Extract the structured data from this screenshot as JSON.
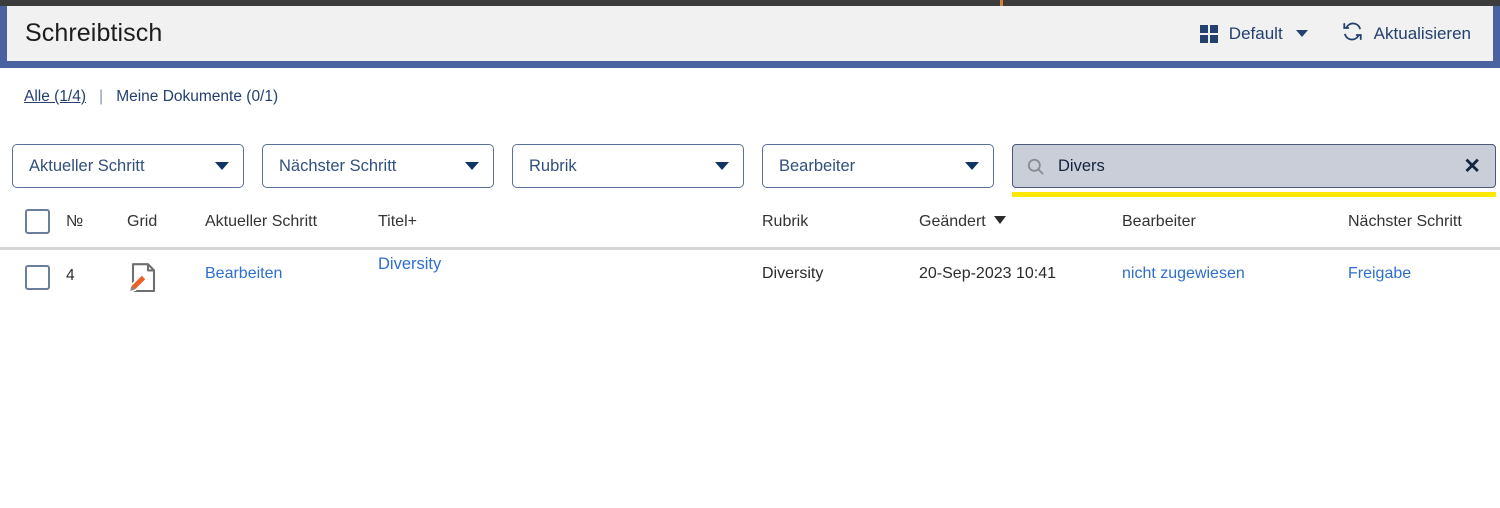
{
  "header": {
    "title": "Schreibtisch",
    "view_button": {
      "label": "Default",
      "icon": "grid-icon"
    },
    "refresh_button": {
      "label": "Aktualisieren",
      "icon": "refresh-icon"
    }
  },
  "filter_tabs": {
    "separator": "|",
    "items": [
      {
        "label": "Alle (1/4)",
        "active": true
      },
      {
        "label": "Meine Dokumente (0/1)",
        "active": false
      }
    ]
  },
  "filters": {
    "dropdowns": [
      {
        "label": "Aktueller Schritt"
      },
      {
        "label": "Nächster Schritt"
      },
      {
        "label": "Rubrik"
      },
      {
        "label": "Bearbeiter"
      }
    ],
    "search": {
      "value": "Divers",
      "placeholder": "",
      "icon": "search-icon",
      "clear_icon": "✕"
    }
  },
  "table": {
    "columns": [
      {
        "key": "checkbox",
        "label": ""
      },
      {
        "key": "no",
        "label": "№"
      },
      {
        "key": "grid",
        "label": "Grid"
      },
      {
        "key": "current_step",
        "label": "Aktueller Schritt"
      },
      {
        "key": "title",
        "label": "Titel+"
      },
      {
        "key": "rubrik",
        "label": "Rubrik"
      },
      {
        "key": "changed",
        "label": "Geändert",
        "sorted": true,
        "sort_icon": "chevron-down-icon"
      },
      {
        "key": "bearbeiter",
        "label": "Bearbeiter"
      },
      {
        "key": "next_step",
        "label": "Nächster Schritt"
      }
    ],
    "rows": [
      {
        "no": "4",
        "grid_icon": "document-edit-icon",
        "current_step": "Bearbeiten",
        "title": "Diversity",
        "rubrik": "Diversity",
        "changed": "20-Sep-2023 10:41",
        "bearbeiter": "nicht zugewiesen",
        "next_step": "Freigabe"
      }
    ]
  },
  "colors": {
    "accent_blue": "#4a63a0",
    "link_blue": "#2e6ed0",
    "highlight_yellow": "#ffe800",
    "header_bg": "#f1f1f1",
    "search_bg": "#c9ced8"
  }
}
